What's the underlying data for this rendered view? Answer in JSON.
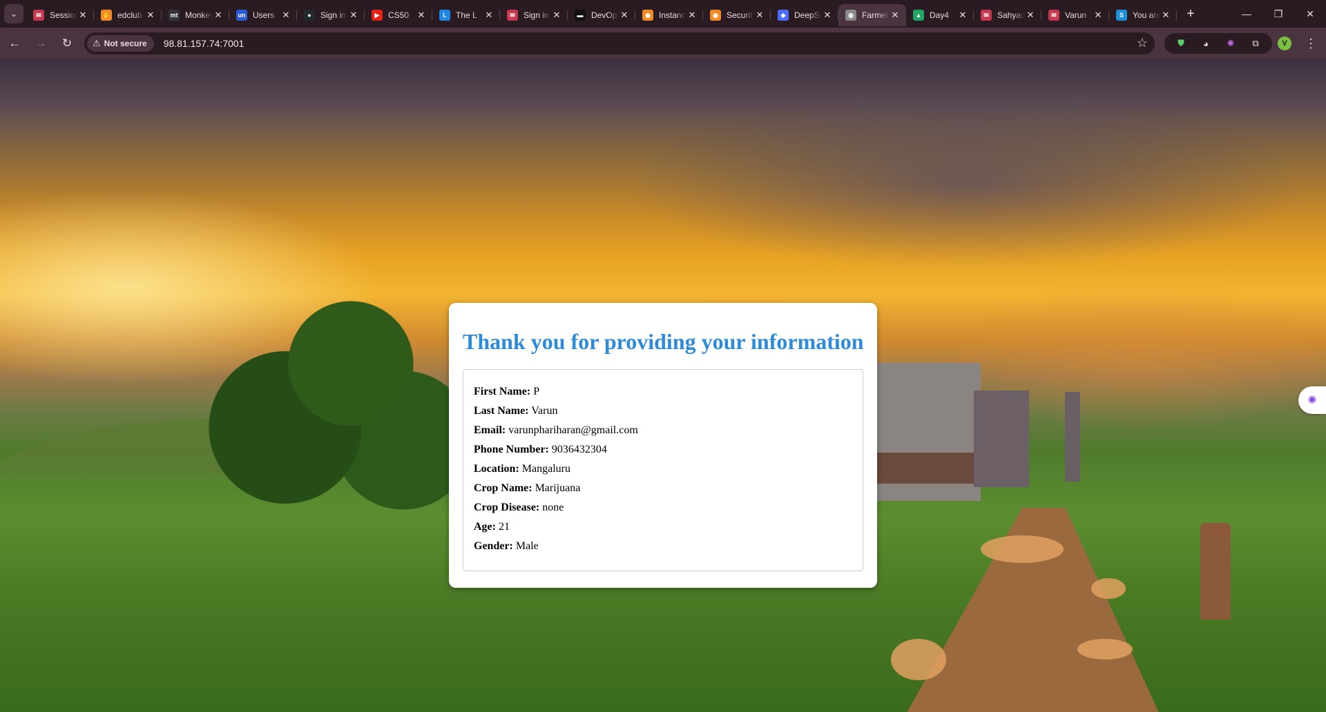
{
  "browser": {
    "tabs": [
      {
        "title": "Session",
        "favicon": "mail-icon",
        "color": "#c53a50",
        "glyph": "✉",
        "active": false
      },
      {
        "title": "edclub",
        "favicon": "hand-icon",
        "color": "#f28c28",
        "glyph": "✋",
        "active": false
      },
      {
        "title": "Monkeytype",
        "favicon": "monkeytype-icon",
        "color": "#323437",
        "glyph": "mt",
        "active": false
      },
      {
        "title": "Users",
        "favicon": "un-icon",
        "color": "#2a5bd7",
        "glyph": "un",
        "active": false
      },
      {
        "title": "Sign in",
        "favicon": "github-icon",
        "color": "#24292e",
        "glyph": "●",
        "active": false
      },
      {
        "title": "CS50",
        "favicon": "youtube-icon",
        "color": "#e62117",
        "glyph": "▶",
        "active": false
      },
      {
        "title": "The L",
        "favicon": "l-icon",
        "color": "#1e88e5",
        "glyph": "L",
        "active": false
      },
      {
        "title": "Sign in",
        "favicon": "mail-icon",
        "color": "#c53a50",
        "glyph": "✉",
        "active": false
      },
      {
        "title": "DevOps",
        "favicon": "devops-icon",
        "color": "#111111",
        "glyph": "▬",
        "active": false
      },
      {
        "title": "Instance",
        "favicon": "aws-icon",
        "color": "#f08a24",
        "glyph": "◉",
        "active": false
      },
      {
        "title": "Security",
        "favicon": "aws-icon",
        "color": "#f08a24",
        "glyph": "◉",
        "active": false
      },
      {
        "title": "DeepSeek",
        "favicon": "deepseek-icon",
        "color": "#4d6bfe",
        "glyph": "◆",
        "active": false
      },
      {
        "title": "Farmer",
        "favicon": "globe-icon",
        "color": "#8a8a8a",
        "glyph": "◍",
        "active": true
      },
      {
        "title": "Day4",
        "favicon": "drive-icon",
        "color": "#1fa463",
        "glyph": "▲",
        "active": false
      },
      {
        "title": "Sahyadri",
        "favicon": "mail-icon",
        "color": "#c53a50",
        "glyph": "✉",
        "active": false
      },
      {
        "title": "Varun",
        "favicon": "mail-icon",
        "color": "#c53a50",
        "glyph": "✉",
        "active": false
      },
      {
        "title": "You are",
        "favicon": "s-icon",
        "color": "#1e90d8",
        "glyph": "S",
        "active": false
      }
    ],
    "security_label": "Not secure",
    "url": "98.81.157.74:7001",
    "profile_initial": "V"
  },
  "page": {
    "title": "Thank you for providing your information",
    "fields": [
      {
        "label": "First Name:",
        "value": "P"
      },
      {
        "label": "Last Name:",
        "value": "Varun"
      },
      {
        "label": "Email:",
        "value": "varunphariharan@gmail.com"
      },
      {
        "label": "Phone Number:",
        "value": "9036432304"
      },
      {
        "label": "Location:",
        "value": "Mangaluru"
      },
      {
        "label": "Crop Name:",
        "value": "Marijuana"
      },
      {
        "label": "Crop Disease:",
        "value": "none"
      },
      {
        "label": "Age:",
        "value": "21"
      },
      {
        "label": "Gender:",
        "value": "Male"
      }
    ],
    "title_color": "#2d8bd9"
  }
}
